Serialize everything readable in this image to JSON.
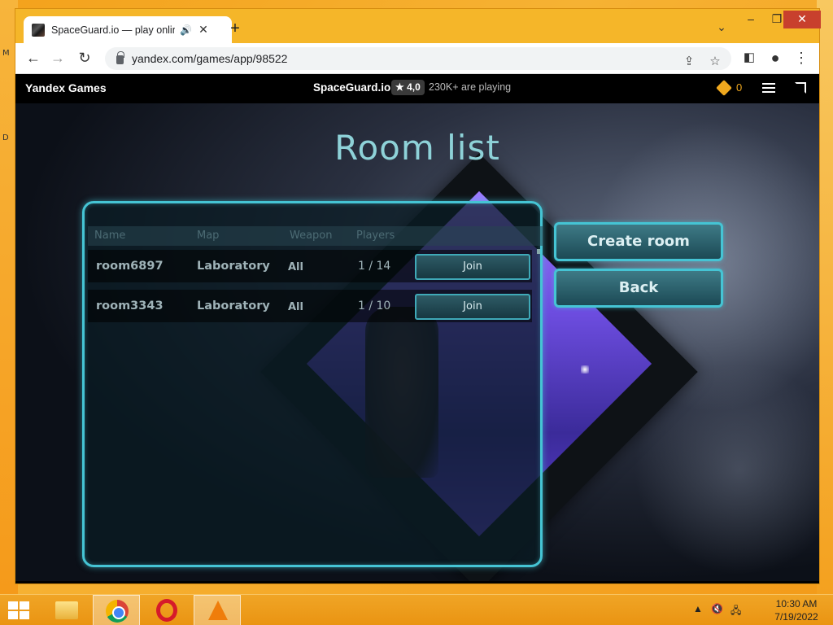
{
  "browser": {
    "tab_title": "SpaceGuard.io — play online",
    "url": "yandex.com/games/app/98522",
    "icons": [
      "back-icon",
      "forward-icon",
      "reload-icon",
      "lock-icon",
      "share-icon",
      "star-icon",
      "sidepanel-icon",
      "profile-icon",
      "more-icon"
    ]
  },
  "gamebar": {
    "brand": "Yandex Games",
    "game_name": "SpaceGuard.io",
    "rating": "★ 4,0",
    "players_online": "230K+ are playing",
    "gems": "0"
  },
  "game": {
    "title": "Room list",
    "columns": [
      "Name",
      "Map",
      "Weapon",
      "Players"
    ],
    "rooms": [
      {
        "name": "room6897",
        "map": "Laboratory",
        "weapon": "All",
        "players": "1 / 14",
        "action": "Join"
      },
      {
        "name": "room3343",
        "map": "Laboratory",
        "weapon": "All",
        "players": "1 / 10",
        "action": "Join"
      }
    ],
    "create_room": "Create room",
    "back": "Back",
    "accent_color": "#45c4d4"
  },
  "taskbar": {
    "apps": [
      "file-explorer",
      "chrome",
      "opera",
      "vlc"
    ],
    "time": "10:30 AM",
    "date": "7/19/2022"
  },
  "desktop": {
    "left_glyphs": [
      "M",
      "D"
    ]
  }
}
